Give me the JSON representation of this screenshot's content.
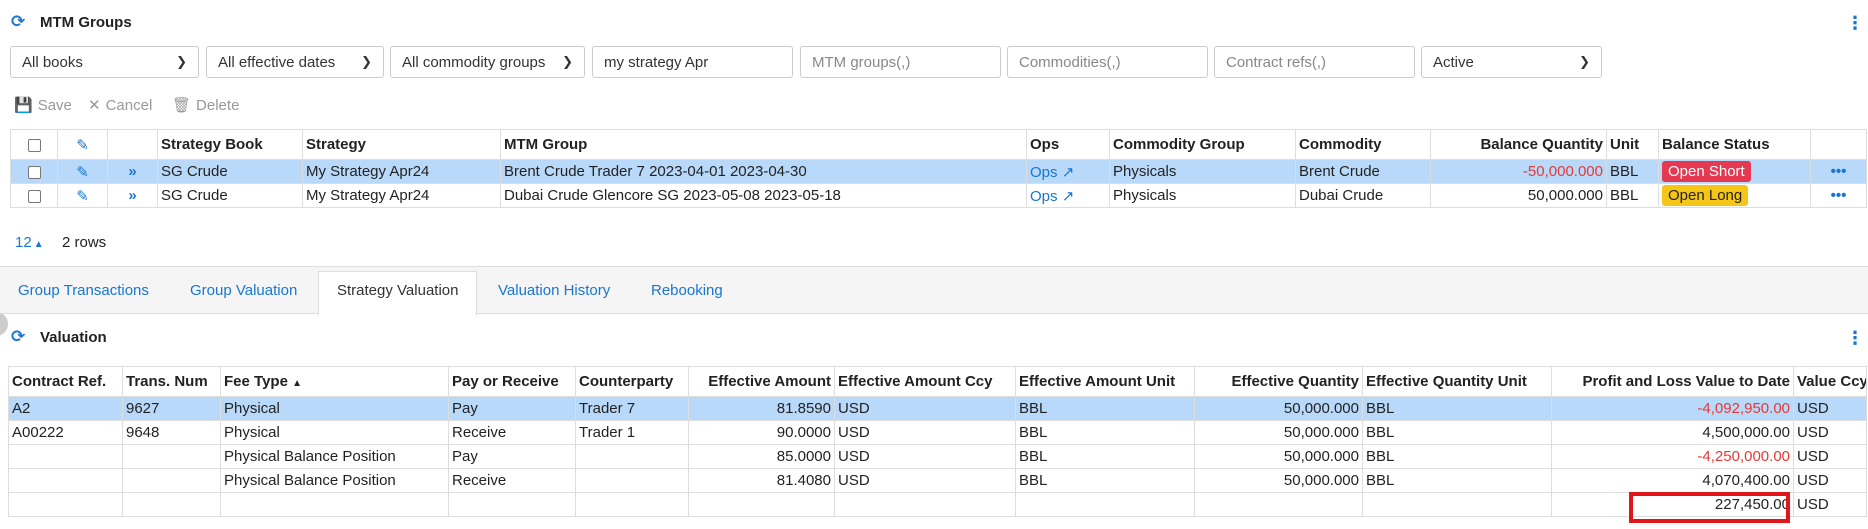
{
  "mtm": {
    "title": "MTM Groups",
    "filters": {
      "books": "All books",
      "dates": "All effective dates",
      "commodity_groups": "All commodity groups",
      "strategy": "my strategy Apr",
      "mtm_groups_ph": "MTM groups(,)",
      "commodities_ph": "Commodities(,)",
      "contract_refs_ph": "Contract refs(,)",
      "status": "Active"
    },
    "toolbar": {
      "save": "Save",
      "cancel": "Cancel",
      "delete": "Delete"
    },
    "columns": [
      "Strategy Book",
      "Strategy",
      "MTM Group",
      "Ops",
      "Commodity Group",
      "Commodity",
      "Balance Quantity",
      "Unit",
      "Balance Status"
    ],
    "rows": [
      {
        "book": "SG Crude",
        "strategy": "My Strategy Apr24",
        "group": "Brent Crude Trader 7 2023-04-01 2023-04-30",
        "ops": "Ops",
        "commodity_group": "Physicals",
        "commodity": "Brent Crude",
        "qty": "-50,000.000",
        "unit": "BBL",
        "status": "Open Short"
      },
      {
        "book": "SG Crude",
        "strategy": "My Strategy Apr24",
        "group": "Dubai Crude Glencore SG 2023-05-08 2023-05-18",
        "ops": "Ops",
        "commodity_group": "Physicals",
        "commodity": "Dubai Crude",
        "qty": "50,000.000",
        "unit": "BBL",
        "status": "Open Long"
      }
    ],
    "page_size": "12",
    "row_count": "2 rows"
  },
  "tabs": [
    "Group Transactions",
    "Group Valuation",
    "Strategy Valuation",
    "Valuation History",
    "Rebooking"
  ],
  "valuation": {
    "title": "Valuation",
    "columns": [
      "Contract Ref.",
      "Trans. Num",
      "Fee Type",
      "Pay or Receive",
      "Counterparty",
      "Effective Amount",
      "Effective Amount Ccy",
      "Effective Amount Unit",
      "Effective Quantity",
      "Effective Quantity Unit",
      "Profit and Loss Value to Date",
      "Value Ccy"
    ],
    "rows": [
      {
        "ref": "A2",
        "num": "9627",
        "fee": "Physical",
        "pr": "Pay",
        "cp": "Trader 7",
        "amt": "81.8590",
        "ccy": "USD",
        "unit": "BBL",
        "qty": "50,000.000",
        "qunit": "BBL",
        "pnl": "-4,092,950.00",
        "vccy": "USD"
      },
      {
        "ref": "A00222",
        "num": "9648",
        "fee": "Physical",
        "pr": "Receive",
        "cp": "Trader 1",
        "amt": "90.0000",
        "ccy": "USD",
        "unit": "BBL",
        "qty": "50,000.000",
        "qunit": "BBL",
        "pnl": "4,500,000.00",
        "vccy": "USD"
      },
      {
        "ref": "",
        "num": "",
        "fee": "Physical Balance Position",
        "pr": "Pay",
        "cp": "",
        "amt": "85.0000",
        "ccy": "USD",
        "unit": "BBL",
        "qty": "50,000.000",
        "qunit": "BBL",
        "pnl": "-4,250,000.00",
        "vccy": "USD"
      },
      {
        "ref": "",
        "num": "",
        "fee": "Physical Balance Position",
        "pr": "Receive",
        "cp": "",
        "amt": "81.4080",
        "ccy": "USD",
        "unit": "BBL",
        "qty": "50,000.000",
        "qunit": "BBL",
        "pnl": "4,070,400.00",
        "vccy": "USD"
      }
    ],
    "total": {
      "pnl": "227,450.00",
      "vccy": "USD"
    }
  },
  "colors": {
    "accent": "#1976d2",
    "negative": "#e53935",
    "open_short": "#e53952",
    "open_long": "#f5c518",
    "selected_row": "#b9d9fb"
  }
}
